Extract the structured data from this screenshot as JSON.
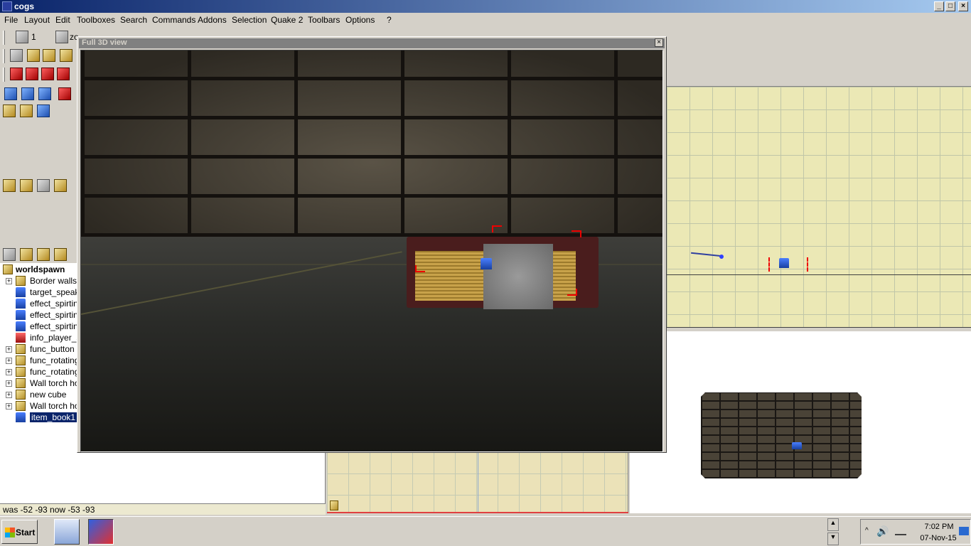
{
  "window": {
    "title": "cogs"
  },
  "menu": [
    "File",
    "Layout",
    "Edit",
    "Toolboxes",
    "Search",
    "Commands",
    "Addons",
    "Selection",
    "Quake 2",
    "Toolbars",
    "Options",
    "?"
  ],
  "toolbar": {
    "grid_value": "1",
    "zoom_label": "zo"
  },
  "view3d": {
    "title": "Full 3D view"
  },
  "tree": {
    "root": "worldspawn",
    "items": [
      {
        "label": "Border walls",
        "icon": "brush-icon",
        "expand": true
      },
      {
        "label": "target_speake",
        "icon": "entity-icon",
        "expand": false
      },
      {
        "label": "effect_spirting",
        "icon": "entity-icon",
        "expand": false
      },
      {
        "label": "effect_spirting",
        "icon": "entity-icon",
        "expand": false
      },
      {
        "label": "effect_spirting",
        "icon": "entity-icon",
        "expand": false
      },
      {
        "label": "info_player_st",
        "icon": "player-start-icon",
        "expand": false
      },
      {
        "label": "func_button",
        "icon": "brush-entity-icon",
        "expand": true
      },
      {
        "label": "func_rotating",
        "icon": "brush-entity-icon",
        "expand": true
      },
      {
        "label": "func_rotating",
        "icon": "brush-entity-icon",
        "expand": true
      },
      {
        "label": "Wall torch hol",
        "icon": "group-icon",
        "expand": true
      },
      {
        "label": "new cube",
        "icon": "brush-icon",
        "expand": true
      },
      {
        "label": "Wall torch hol",
        "icon": "group-icon",
        "expand": true
      },
      {
        "label": "item_book1",
        "icon": "entity-icon",
        "expand": false,
        "selected": true
      }
    ]
  },
  "status": {
    "text": "was -52 -93 now -53 -93"
  },
  "taskbar": {
    "start_label": "Start",
    "time": "7:02 PM",
    "date": "07-Nov-15"
  },
  "colors": {
    "title_start": "#0a246a",
    "title_end": "#a6caf0",
    "map_grid_bg": "#ebe8b5",
    "selection_red": "#e00000"
  }
}
